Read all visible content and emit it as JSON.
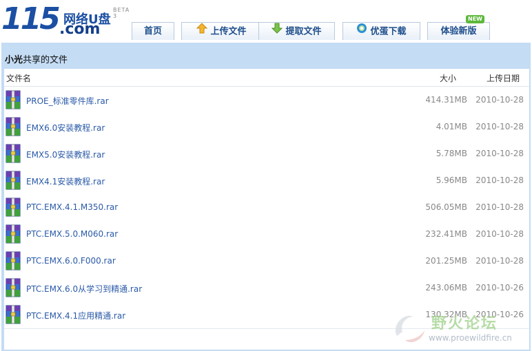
{
  "logo": {
    "number": "115",
    "cn_name": "网络U盘",
    "domain": ".com",
    "beta": "BETA 3"
  },
  "nav": [
    {
      "label": "首页",
      "icon": "home-icon"
    },
    {
      "label": "上传文件",
      "icon": "upload-arrow-icon"
    },
    {
      "label": "提取文件",
      "icon": "download-arrow-icon"
    },
    {
      "label": "优蛋下载",
      "icon": "youdan-egg-icon"
    },
    {
      "label": "体验新版",
      "icon": "new-version-icon"
    }
  ],
  "new_badge": "NEW",
  "panel": {
    "owner": "小光",
    "title_suffix": "共享的文件"
  },
  "table": {
    "headers": {
      "name": "文件名",
      "size": "大小",
      "date": "上传日期"
    },
    "rows": [
      {
        "name": "PROE_标准零件库.rar",
        "size": "414.31MB",
        "date": "2010-10-28"
      },
      {
        "name": "EMX6.0安装教程.rar",
        "size": "4.01MB",
        "date": "2010-10-28"
      },
      {
        "name": "EMX5.0安装教程.rar",
        "size": "5.78MB",
        "date": "2010-10-28"
      },
      {
        "name": "EMX4.1安装教程.rar",
        "size": "5.96MB",
        "date": "2010-10-28"
      },
      {
        "name": "PTC.EMX.4.1.M350.rar",
        "size": "506.05MB",
        "date": "2010-10-28"
      },
      {
        "name": "PTC.EMX.5.0.M060.rar",
        "size": "232.41MB",
        "date": "2010-10-28"
      },
      {
        "name": "PTC.EMX.6.0.F000.rar",
        "size": "201.25MB",
        "date": "2010-10-28"
      },
      {
        "name": "PTC.EMX.6.0从学习到精通.rar",
        "size": "243.06MB",
        "date": "2010-10-26"
      },
      {
        "name": "PTC.EMX.4.1应用精通.rar",
        "size": "130.32MB",
        "date": "2010-10-26"
      }
    ]
  },
  "watermark": {
    "text": "野火论坛",
    "url": "www.proewildfire.cn"
  },
  "colors": {
    "panel_bg": "#c4dcf4",
    "link": "#2a5aa8",
    "nav_text": "#1e4e8c",
    "logo_blue": "#1b4fa3",
    "logo_green": "#3aa63a"
  }
}
